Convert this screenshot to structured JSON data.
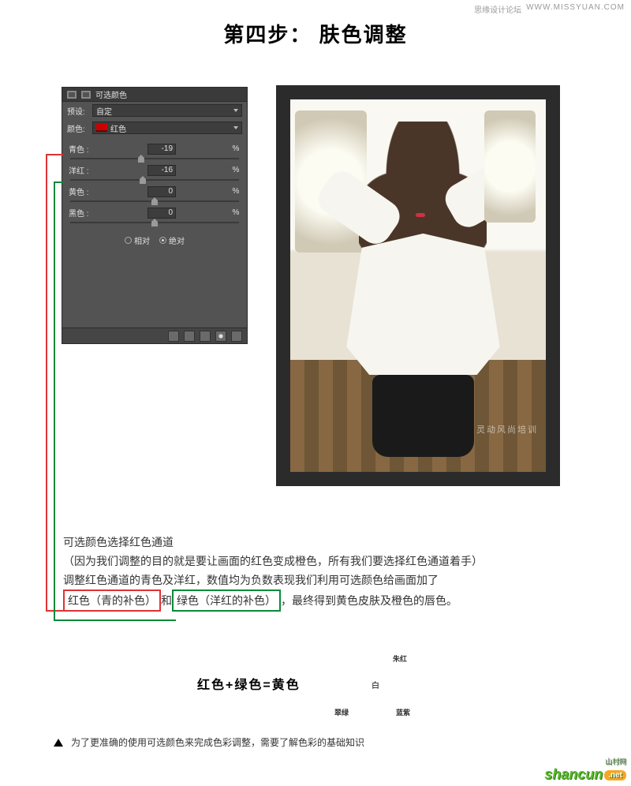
{
  "watermark": {
    "site_cn": "思缘设计论坛",
    "site_url": "WWW.MISSYUAN.COM"
  },
  "title": "第四步： 肤色调整",
  "panel": {
    "tab": "可选颜色",
    "preset_label": "预设:",
    "preset_value": "自定",
    "color_label": "颜色:",
    "color_value": "红色",
    "sliders": {
      "cyan": {
        "label": "青色 :",
        "value": "-19",
        "pct": "%",
        "pos": 42
      },
      "magenta": {
        "label": "洋红 :",
        "value": "-16",
        "pct": "%",
        "pos": 43
      },
      "yellow": {
        "label": "黄色 :",
        "value": "0",
        "pct": "%",
        "pos": 50
      },
      "black": {
        "label": "黑色 :",
        "value": "0",
        "pct": "%",
        "pos": 50
      }
    },
    "mode": {
      "relative": "相对",
      "absolute": "绝对"
    }
  },
  "photo_watermark": "灵动风尚培训",
  "notes": {
    "l1": "可选颜色选择红色通道",
    "l2": "（因为我们调整的目的就是要让画面的红色变成橙色，所有我们要选择红色通道着手）",
    "l3": "调整红色通道的青色及洋红，数值均为负数表现我们利用可选颜色给画面加了",
    "hl_red": "红色（青的补色）",
    "mid": "和",
    "hl_green": "绿色（洋红的补色）",
    "tail": "，最终得到黄色皮肤及橙色的唇色。"
  },
  "equation": "红色+绿色=黄色",
  "venn": {
    "red": "朱红",
    "green": "翠绿",
    "blue": "蓝紫",
    "white": "白"
  },
  "bottom_note": "为了更准确的使用可选颜色来完成色彩调整，需要了解色彩的基础知识",
  "logo": {
    "brand": "shancun",
    "tld": ".net",
    "cn": "山村网"
  }
}
